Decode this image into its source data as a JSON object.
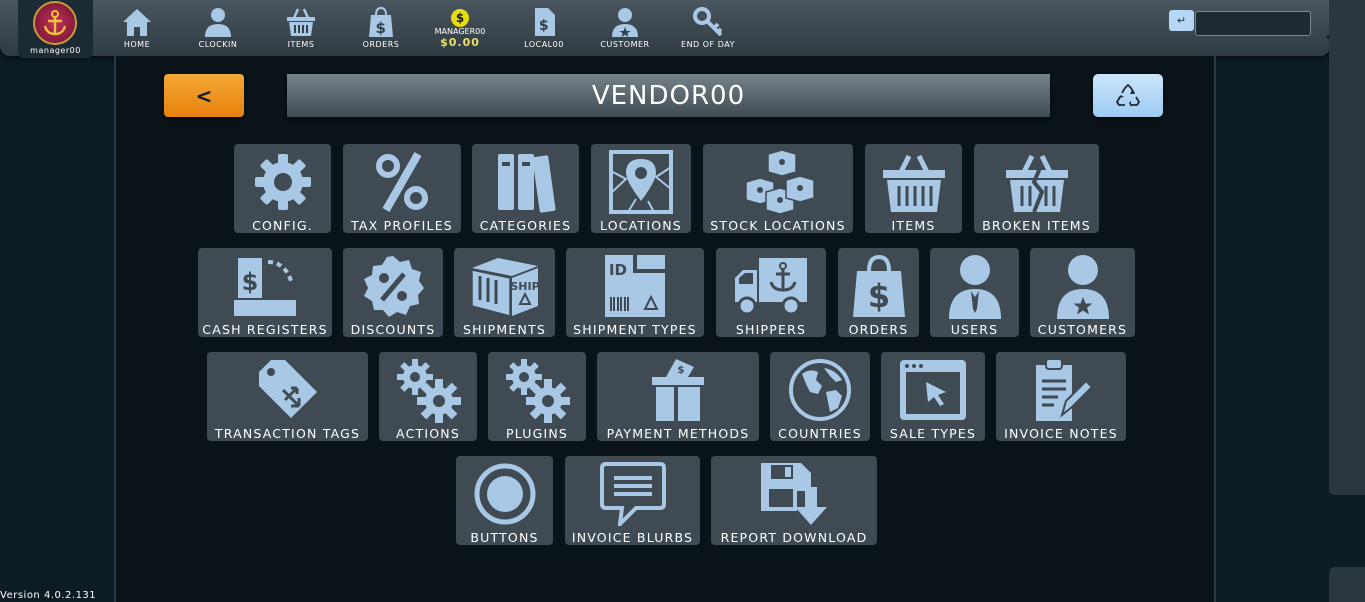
{
  "topbar": {
    "logo_label": "manager00",
    "nav": [
      {
        "label": "HOME",
        "icon": "home-icon"
      },
      {
        "label": "CLOCKIN",
        "icon": "user-icon"
      },
      {
        "label": "ITEMS",
        "icon": "basket-icon"
      },
      {
        "label": "ORDERS",
        "icon": "dollar-bag-icon"
      },
      {
        "label": "LOCAL00",
        "icon": "receipt-icon"
      },
      {
        "label": "CUSTOMER",
        "icon": "customer-icon"
      },
      {
        "label": "END OF DAY",
        "icon": "key-icon"
      }
    ],
    "user": {
      "name": "MANAGER00",
      "coin_symbol": "$",
      "amount": "$0.00"
    },
    "enter_symbol": "↵",
    "search_value": ""
  },
  "header": {
    "back_label": "<",
    "title": "VENDOR00"
  },
  "tiles": [
    {
      "label": "CONFIG.",
      "icon": "gear-icon"
    },
    {
      "label": "TAX PROFILES",
      "icon": "percent-icon"
    },
    {
      "label": "CATEGORIES",
      "icon": "binders-icon"
    },
    {
      "label": "LOCATIONS",
      "icon": "map-pin-icon"
    },
    {
      "label": "STOCK LOCATIONS",
      "icon": "boxes-icon"
    },
    {
      "label": "ITEMS",
      "icon": "basket-icon"
    },
    {
      "label": "BROKEN ITEMS",
      "icon": "broken-basket-icon"
    },
    {
      "label": "CASH REGISTERS",
      "icon": "cash-register-icon"
    },
    {
      "label": "DISCOUNTS",
      "icon": "discount-badge-icon"
    },
    {
      "label": "SHIPMENTS",
      "icon": "ship-box-icon"
    },
    {
      "label": "SHIPMENT TYPES",
      "icon": "id-box-icon"
    },
    {
      "label": "SHIPPERS",
      "icon": "truck-icon"
    },
    {
      "label": "ORDERS",
      "icon": "dollar-bag-icon"
    },
    {
      "label": "USERS",
      "icon": "user-icon"
    },
    {
      "label": "CUSTOMERS",
      "icon": "customer-icon"
    },
    {
      "label": "TRANSACTION TAGS",
      "icon": "tag-icon"
    },
    {
      "label": "ACTIONS",
      "icon": "gears-icon"
    },
    {
      "label": "PLUGINS",
      "icon": "gears-icon"
    },
    {
      "label": "PAYMENT METHODS",
      "icon": "payment-box-icon"
    },
    {
      "label": "COUNTRIES",
      "icon": "globe-icon"
    },
    {
      "label": "SALE TYPES",
      "icon": "browser-cursor-icon"
    },
    {
      "label": "INVOICE NOTES",
      "icon": "clipboard-pencil-icon"
    },
    {
      "label": "BUTTONS",
      "icon": "radio-button-icon"
    },
    {
      "label": "INVOICE BLURBS",
      "icon": "speech-bubble-icon"
    },
    {
      "label": "REPORT DOWNLOAD",
      "icon": "save-download-icon"
    }
  ],
  "version": "Version 4.0.2.131",
  "colors": {
    "accent_orange": "#f29a1f",
    "accent_blue": "#a9d3f7",
    "icon_blue": "#a8c8e6",
    "tile": "#3f4a53"
  }
}
